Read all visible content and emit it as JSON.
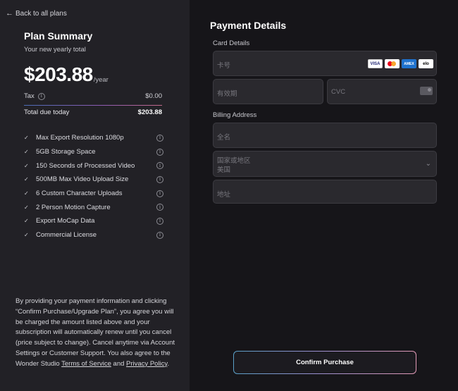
{
  "nav": {
    "back_label": "Back to all plans"
  },
  "plan": {
    "title": "Plan Summary",
    "subtitle": "Your new yearly total",
    "price": "$203.88",
    "period": "/year",
    "tax_label": "Tax",
    "tax_value": "$0.00",
    "total_label": "Total due today",
    "total_value": "$203.88",
    "features": [
      "Max Export Resolution 1080p",
      "5GB Storage Space",
      "150 Seconds of Processed Video",
      "500MB Max Video Upload Size",
      "6 Custom Character Uploads",
      "2 Person Motion Capture",
      "Export MoCap Data",
      "Commercial License"
    ]
  },
  "legal": {
    "text": "By providing your payment information and clicking “Confirm Purchase/Upgrade Plan”, you agree you will be charged the amount listed above and your subscription will automatically renew until you cancel (price subject to change). Cancel anytime via Account Settings or Customer Support. You also agree to the Wonder Studio ",
    "terms_link": "Terms of Service",
    "and": " and ",
    "privacy_link": "Privacy Policy",
    "end": "."
  },
  "payment": {
    "title": "Payment Details",
    "card_section": "Card Details",
    "card_number_placeholder": "卡号",
    "expiry_placeholder": "有效期",
    "cvc_placeholder": "CVC",
    "billing_section": "Billing Address",
    "name_placeholder": "全名",
    "country_label": "国家或地区",
    "country_value": "美国",
    "address_placeholder": "地址",
    "card_brands": [
      "VISA",
      "AMEX",
      "elo"
    ],
    "confirm_label": "Confirm Purchase"
  },
  "icons": {
    "back": "arrow-left-icon",
    "info": "info-icon",
    "check": "check-icon",
    "chevron": "chevron-down-icon"
  }
}
